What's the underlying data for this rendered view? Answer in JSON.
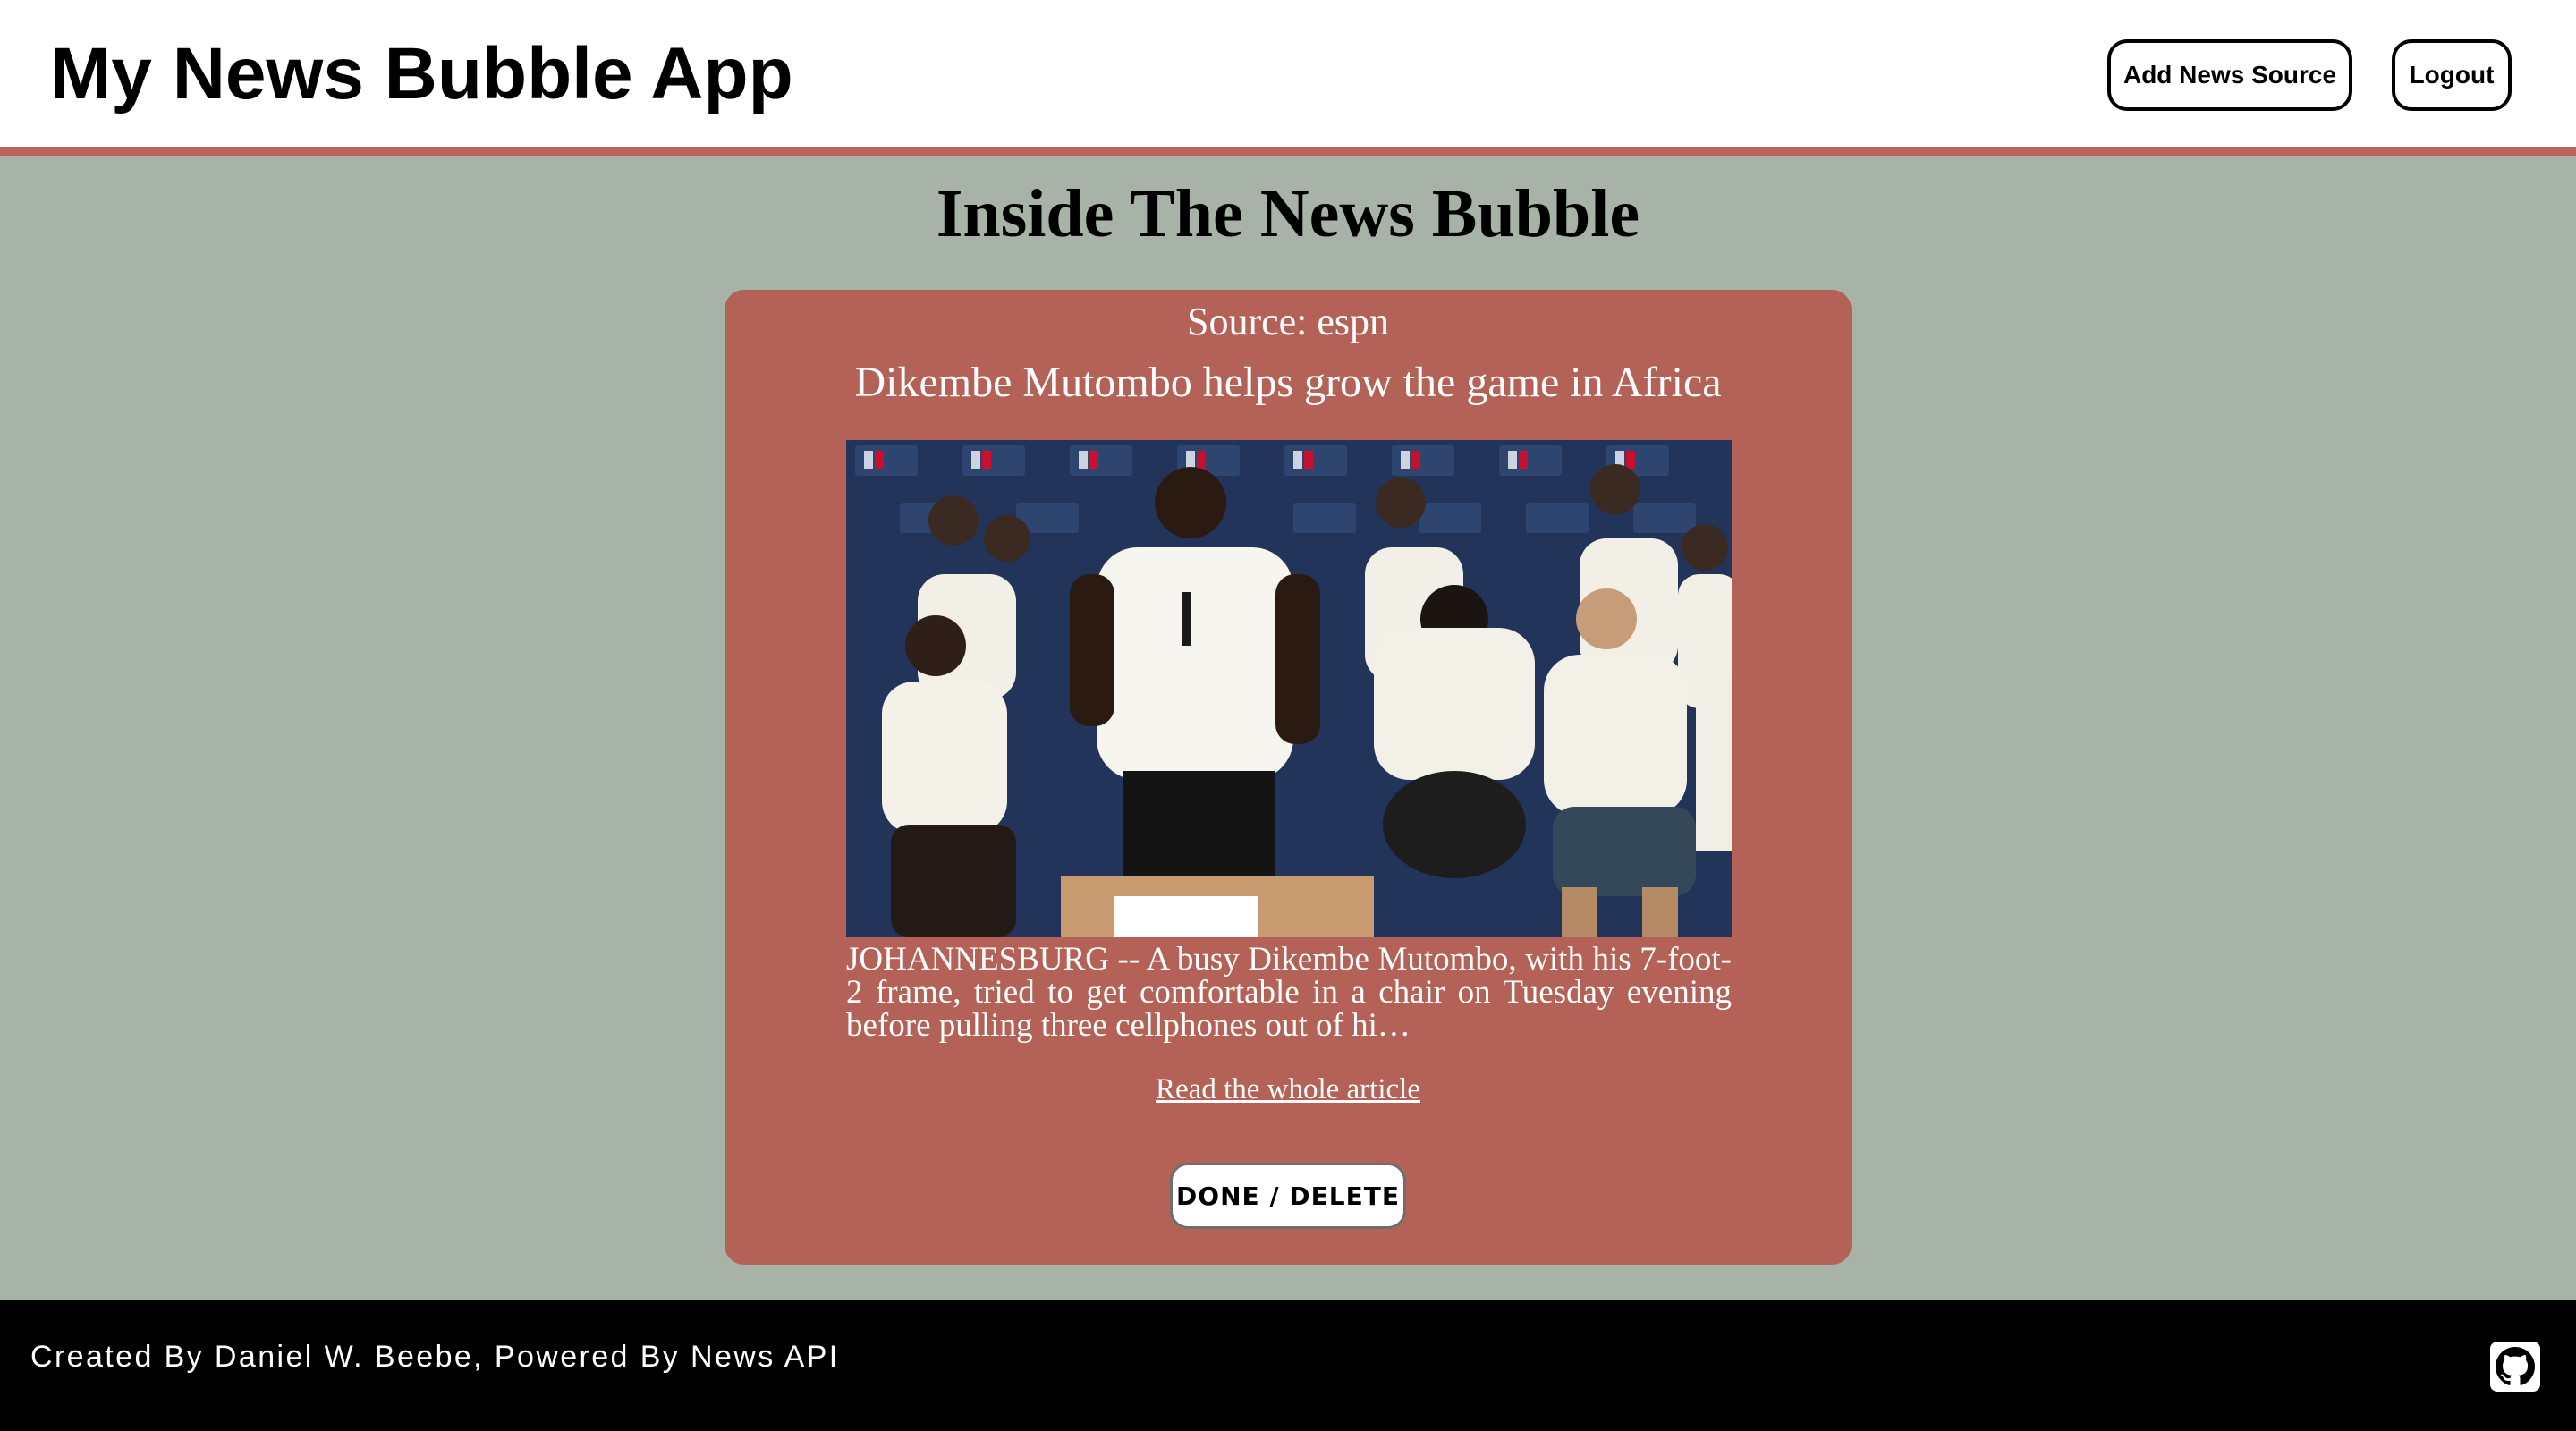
{
  "header": {
    "app_title": "My News Bubble App",
    "add_source_label": "Add News Source",
    "logout_label": "Logout"
  },
  "main": {
    "heading": "Inside The News Bubble"
  },
  "article": {
    "source": "Source: espn",
    "title": "Dikembe Mutombo helps grow the game in Africa",
    "image_icon": "article-photo",
    "description": "JOHANNESBURG -- A busy Dikembe Mutombo, with his 7-foot-2 frame, tried to get comfortable in a chair on Tuesday evening before pulling three cellphones out of hi…",
    "link_label": "Read the whole article",
    "done_label": "DONE / DELETE"
  },
  "footer": {
    "credit": "Created By Daniel W. Beebe, Powered By News API",
    "github_icon": "github-icon"
  },
  "colors": {
    "background": "#a6b3a6",
    "accent": "#b46157",
    "header_border": "#b76457",
    "footer": "#000000"
  }
}
